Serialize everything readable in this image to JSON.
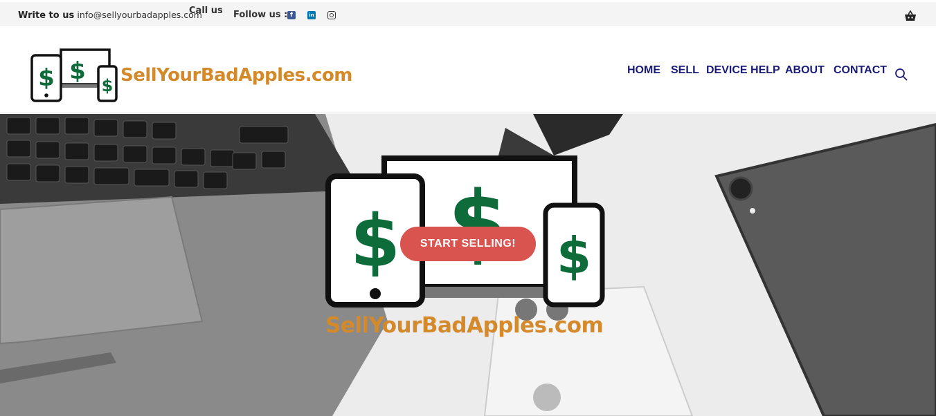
{
  "topbar": {
    "write_label": "Write to us",
    "email": "info@sellyourbadapples.com",
    "call_label": "Call us",
    "follow_label": "Follow us :",
    "social": [
      {
        "icon": "facebook-icon",
        "glyph": "f"
      },
      {
        "icon": "linkedin-icon",
        "glyph": "in"
      },
      {
        "icon": "instagram-icon",
        "glyph": ""
      }
    ],
    "cart_icon": "basket-icon"
  },
  "header": {
    "brand": "SellYourBadApples.com",
    "nav": [
      "HOME",
      "SELL",
      "DEVICE HELP",
      "ABOUT",
      "CONTACT"
    ],
    "search_icon": "search-icon"
  },
  "hero": {
    "cta_label": "START SELLING!",
    "brand": "SellYourBadApples.com"
  },
  "colors": {
    "brand_orange": "#d4892a",
    "dollar_green": "#0e6b3a",
    "nav_blue": "#1a1a7a",
    "cta_red": "#d9534f"
  }
}
